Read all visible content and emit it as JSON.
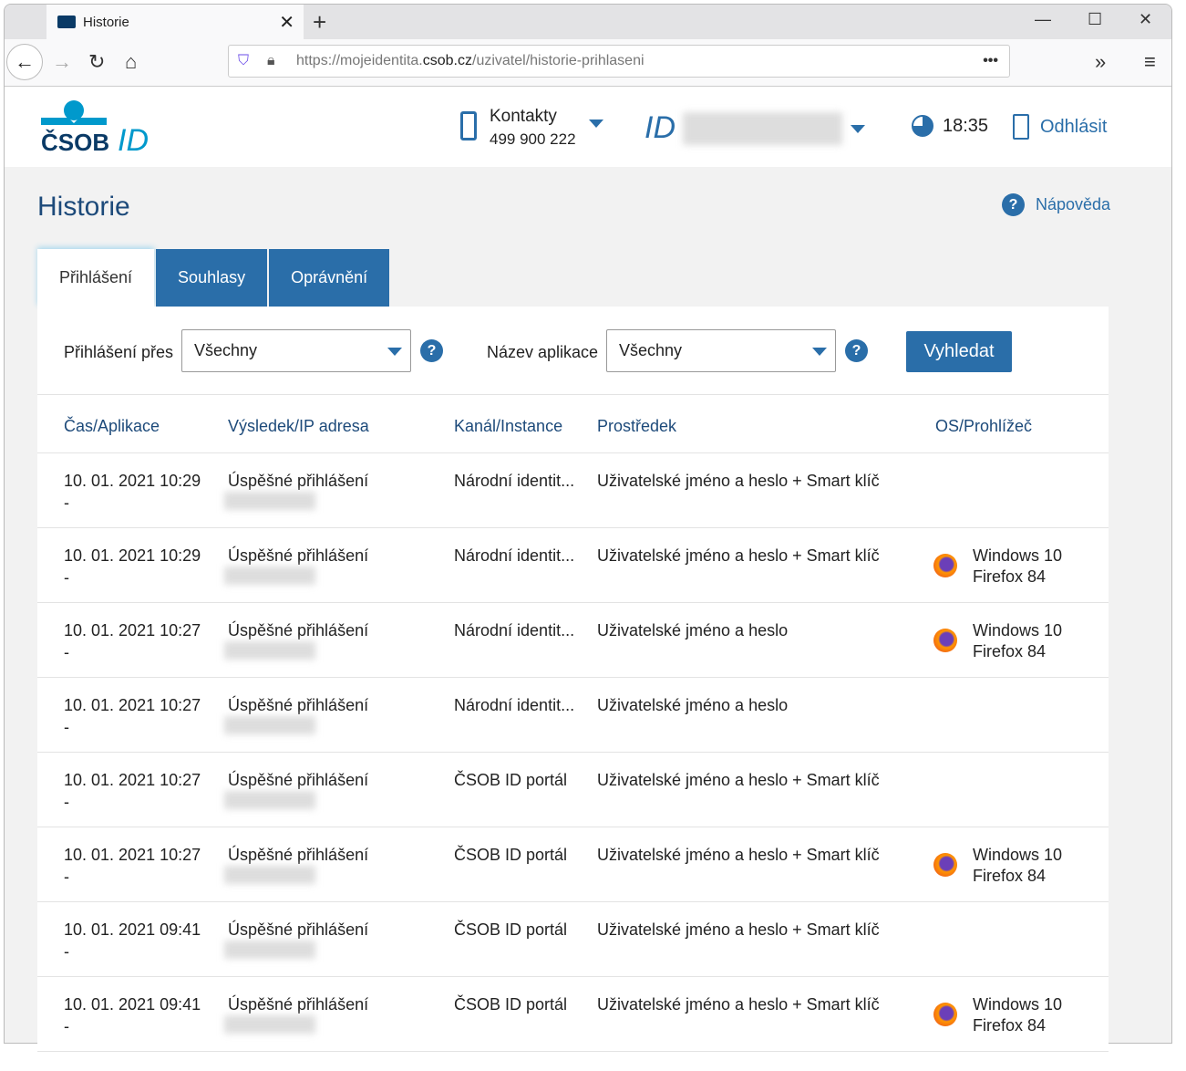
{
  "browser": {
    "tab_title": "Historie",
    "url_host_prefix": "https://mojeidentita.",
    "url_host": "csob.cz",
    "url_path": "/uzivatel/historie-prihlaseni"
  },
  "header": {
    "logo_text": "ČSOB",
    "logo_id": "ID",
    "contacts_label": "Kontakty",
    "contacts_phone": "499 900 222",
    "id_mark": "ID",
    "timer": "18:35",
    "logout": "Odhlásit"
  },
  "page": {
    "title": "Historie",
    "help": "Nápověda"
  },
  "tabs": [
    "Přihlášení",
    "Souhlasy",
    "Oprávnění"
  ],
  "filters": {
    "login_via_label": "Přihlášení přes",
    "login_via_value": "Všechny",
    "app_label": "Název aplikace",
    "app_value": "Všechny",
    "search": "Vyhledat"
  },
  "columns": [
    "Čas/Aplikace",
    "Výsledek/IP adresa",
    "Kanál/Instance",
    "Prostředek",
    "OS/Prohlížeč"
  ],
  "rows": [
    {
      "time": "10. 01. 2021 10:29",
      "app": "-",
      "result": "Úspěšné přihlášení",
      "channel": "Národní identit...",
      "method": "Uživatelské jméno a heslo + Smart klíč",
      "os": "",
      "browser": ""
    },
    {
      "time": "10. 01. 2021 10:29",
      "app": "-",
      "result": "Úspěšné přihlášení",
      "channel": "Národní identit...",
      "method": "Uživatelské jméno a heslo + Smart klíč",
      "os": "Windows 10",
      "browser": "Firefox 84"
    },
    {
      "time": "10. 01. 2021 10:27",
      "app": "-",
      "result": "Úspěšné přihlášení",
      "channel": "Národní identit...",
      "method": "Uživatelské jméno a heslo",
      "os": "Windows 10",
      "browser": "Firefox 84"
    },
    {
      "time": "10. 01. 2021 10:27",
      "app": "-",
      "result": "Úspěšné přihlášení",
      "channel": "Národní identit...",
      "method": "Uživatelské jméno a heslo",
      "os": "",
      "browser": ""
    },
    {
      "time": "10. 01. 2021 10:27",
      "app": "-",
      "result": "Úspěšné přihlášení",
      "channel": "ČSOB ID portál",
      "method": "Uživatelské jméno a heslo + Smart klíč",
      "os": "",
      "browser": ""
    },
    {
      "time": "10. 01. 2021 10:27",
      "app": "-",
      "result": "Úspěšné přihlášení",
      "channel": "ČSOB ID portál",
      "method": "Uživatelské jméno a heslo + Smart klíč",
      "os": "Windows 10",
      "browser": "Firefox 84"
    },
    {
      "time": "10. 01. 2021 09:41",
      "app": "-",
      "result": "Úspěšné přihlášení",
      "channel": "ČSOB ID portál",
      "method": "Uživatelské jméno a heslo + Smart klíč",
      "os": "",
      "browser": ""
    },
    {
      "time": "10. 01. 2021 09:41",
      "app": "-",
      "result": "Úspěšné přihlášení",
      "channel": "ČSOB ID portál",
      "method": "Uživatelské jméno a heslo + Smart klíč",
      "os": "Windows 10",
      "browser": "Firefox 84"
    }
  ]
}
